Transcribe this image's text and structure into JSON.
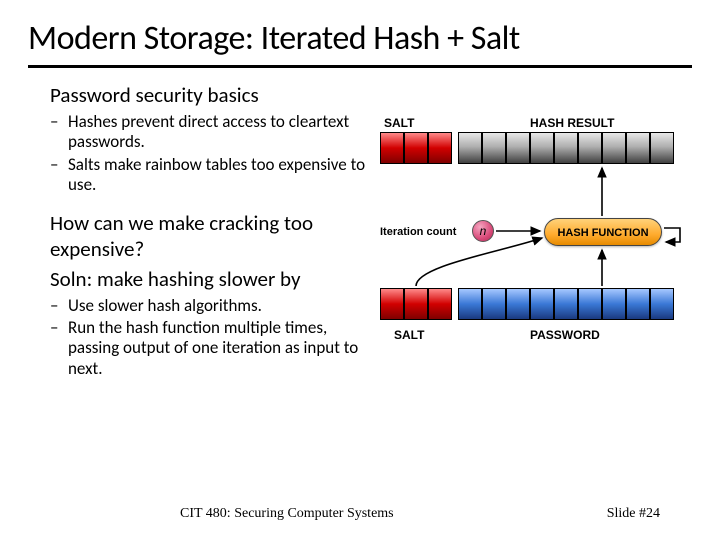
{
  "title": "Modern Storage: Iterated Hash + Salt",
  "section1": {
    "heading": "Password security basics",
    "bullets": [
      "Hashes prevent direct access to cleartext passwords.",
      "Salts make rainbow tables too expensive to use."
    ]
  },
  "section2": {
    "q": "How can we make cracking too expensive?",
    "a": "Soln: make hashing slower by",
    "bullets": [
      "Use slower hash algorithms.",
      "Run the hash function multiple times, passing output of one iteration as input to next."
    ]
  },
  "diagram": {
    "top_salt_label": "SALT",
    "top_hash_label": "HASH RESULT",
    "hash_fn_label": "HASH FUNCTION",
    "iter_label": "Iteration count",
    "iter_symbol": "n",
    "bottom_salt_label": "SALT",
    "bottom_pass_label": "PASSWORD"
  },
  "footer": {
    "course": "CIT 480: Securing Computer Systems",
    "slide": "Slide #24"
  }
}
